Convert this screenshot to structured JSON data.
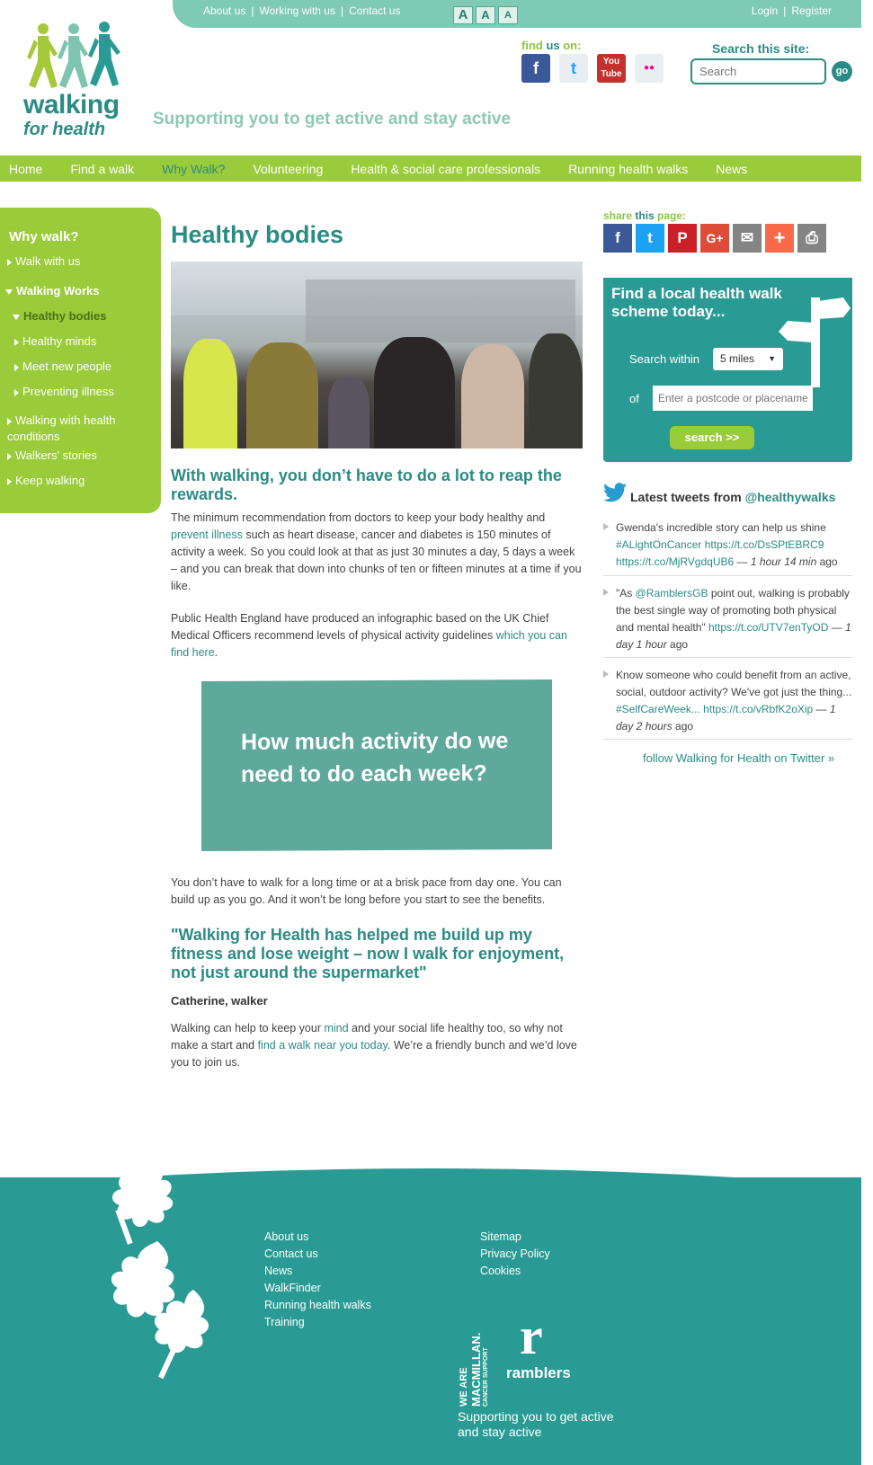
{
  "topbar": {
    "links": [
      "About us",
      "Working with us",
      "Contact us"
    ],
    "separator": "|",
    "text_size_glyphs": [
      "A",
      "A",
      "A"
    ],
    "login": "Login",
    "register": "Register"
  },
  "brand": {
    "logo_line1": "walking",
    "logo_line2": "for health",
    "tagline": "Supporting you to get active and stay active"
  },
  "findus": {
    "label_pre": "find",
    "label_mid": " us",
    "label_post": " on:",
    "icons": [
      "facebook-icon",
      "twitter-icon",
      "youtube-icon",
      "flickr-icon"
    ],
    "glyphs": [
      "f",
      "t",
      "You Tube",
      "●●"
    ]
  },
  "search": {
    "label": "Search this site:",
    "placeholder": "Search",
    "button": "go"
  },
  "nav": {
    "items": [
      "Home",
      "Find a walk",
      "Why Walk?",
      "Volunteering",
      "Health & social care professionals",
      "Running health walks",
      "News"
    ],
    "active_index": 2
  },
  "sidebar": {
    "title": "Why walk?",
    "items": [
      "Walk with us",
      "Walking Works",
      "Healthy bodies",
      "Healthy minds",
      "Meet new people",
      "Preventing illness",
      "Walking with health conditions",
      "Walkers' stories",
      "Keep walking"
    ]
  },
  "content": {
    "title": "Healthy bodies",
    "lead": "With walking, you don’t have to do a lot to reap the rewards.",
    "p1_a": "The minimum recommendation from doctors to keep your body healthy and ",
    "p1_link": "prevent illness",
    "p1_b": " such as heart disease, cancer and diabetes is 150 minutes of activity a week. So you could look at that as just 30 minutes a day, 5 days a week – and you can break that down into chunks of ten or fifteen minutes at a time if you like.",
    "p2_a": "Public Health England have produced an infographic based on the UK Chief Medical Officers recommend levels of physical activity guidelines ",
    "p2_link": "which you can find here",
    "p2_b": ".",
    "infographic_text": "How much activity do we need to do each week?",
    "p3": "You don’t have to walk for a long time or at a brisk pace from day one. You can build up as you go. And it won’t be long before you start to see the benefits.",
    "quote": "\"Walking for Health has helped me build up my fitness and lose weight – now I walk for enjoyment, not just around the supermarket\"",
    "quote_author": "Catherine, walker",
    "p4_a": "Walking can help to keep your ",
    "p4_link1": "mind",
    "p4_b": " and your social life healthy too, so why not make a start and ",
    "p4_link2": "find a walk near you today",
    "p4_c": ". We’re a friendly bunch and we’d love you to join us."
  },
  "share": {
    "label_pre": "share",
    "label_mid": " this",
    "label_post": " page:",
    "buttons": [
      {
        "name": "facebook",
        "glyph": "f",
        "color": "#3b5998"
      },
      {
        "name": "twitter",
        "glyph": "t",
        "color": "#1da1f2"
      },
      {
        "name": "pinterest",
        "glyph": "P",
        "color": "#cb2027"
      },
      {
        "name": "google-plus",
        "glyph": "G+",
        "color": "#dd4b39"
      },
      {
        "name": "email",
        "glyph": "✉",
        "color": "#848484"
      },
      {
        "name": "more",
        "glyph": "+",
        "color": "#f96a4b"
      },
      {
        "name": "print",
        "glyph": "⎙",
        "color": "#848484"
      }
    ]
  },
  "walkbox": {
    "heading": "Find a local health walk scheme today...",
    "search_within": "Search within",
    "distance": "5 miles",
    "of": "of",
    "placeholder": "Enter a postcode or placename",
    "button": "search >>"
  },
  "tweets": {
    "heading_pre": "Latest tweets from ",
    "handle": "@healthywalks",
    "items": [
      {
        "text": "Gwenda's incredible story can help us shine ",
        "links": "#ALightOnCancer https://t.co/DsSPtEBRC9 https://t.co/MjRVgdqUB6",
        "sep": " — ",
        "time": "1 hour 14 min",
        "ago": " ago"
      },
      {
        "pre": "\"As ",
        "mention": "@RamblersGB",
        "text": " point out, walking is probably the best single way of promoting both physical and mental health\" ",
        "links": "https://t.co/UTV7enTyOD",
        "sep": " — ",
        "time": "1 day 1 hour",
        "ago": " ago"
      },
      {
        "text": "Know someone who could benefit from an active, social, outdoor activity? We've got just the thing... ",
        "links": "#SelfCareWeek... https://t.co/vRbfK2oXip",
        "sep": " — ",
        "time": "1 day 2 hours",
        "ago": " ago"
      }
    ],
    "follow": "follow Walking for Health on Twitter »"
  },
  "footer": {
    "col1": [
      "About us",
      "Contact us",
      "News",
      "WalkFinder",
      "Running health walks",
      "Training"
    ],
    "col2": [
      "Sitemap",
      "Privacy Policy",
      "Cookies"
    ],
    "macmillan": [
      "WE ARE",
      "MACMILLAN.",
      "CANCER SUPPORT"
    ],
    "ramblers": "ramblers",
    "ramblers_mark": "r",
    "tagline": "Supporting you to get active and stay active"
  },
  "colors": {
    "brand_teal": "#2a8c84",
    "nav_green": "#9acb3b",
    "topbar_mint": "#7ecab5",
    "footer_teal": "#2a9b94"
  }
}
